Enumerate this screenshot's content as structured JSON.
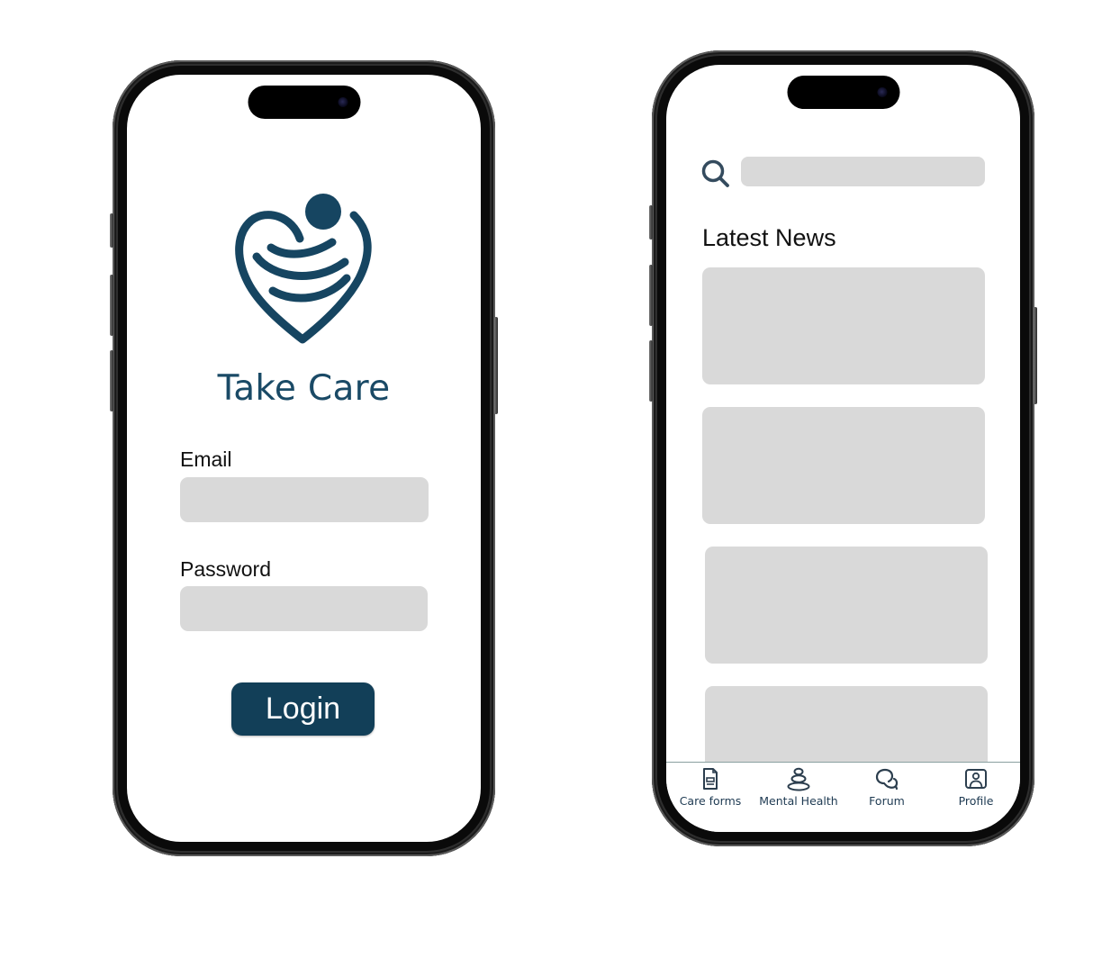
{
  "login_screen": {
    "app_name": "Take Care",
    "logo_icon": "heart-embrace-logo",
    "email": {
      "label": "Email",
      "value": "",
      "placeholder": ""
    },
    "password": {
      "label": "Password",
      "value": "",
      "placeholder": ""
    },
    "login_button": "Login",
    "colors": {
      "brand": "#123f58",
      "title": "#1a4a66",
      "input_bg": "#d9d9d9"
    }
  },
  "news_screen": {
    "search": {
      "icon": "search-icon",
      "value": "",
      "placeholder": ""
    },
    "section_title": "Latest News",
    "news_cards": [
      {
        "id": 1
      },
      {
        "id": 2
      },
      {
        "id": 3
      },
      {
        "id": 4
      }
    ],
    "tabbar": {
      "items": [
        {
          "label": "Care forms",
          "icon": "document-icon"
        },
        {
          "label": "Mental Health",
          "icon": "stacked-stones-icon"
        },
        {
          "label": "Forum",
          "icon": "chat-bubbles-icon"
        },
        {
          "label": "Profile",
          "icon": "profile-icon"
        }
      ]
    }
  }
}
